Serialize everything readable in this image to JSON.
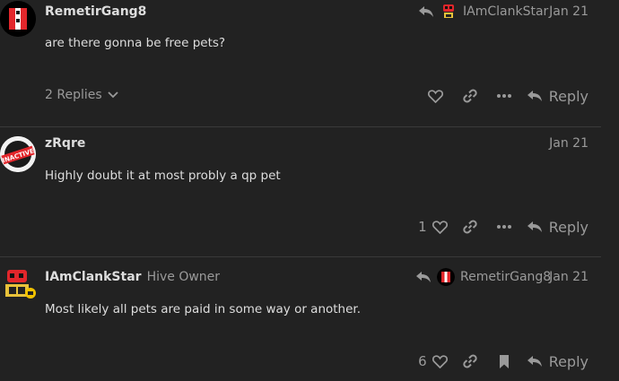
{
  "posts": [
    {
      "username": "RemetirGang8",
      "reply_to_user": "IAmClankStar",
      "date": "Jan 21",
      "body": "are there gonna be free pets?",
      "replies_label": "2 Replies",
      "reply_label": "Reply",
      "like_count": ""
    },
    {
      "username": "zRqre",
      "avatar_badge": "INACTIVE",
      "date": "Jan 21",
      "body": "Highly doubt it at most probly a qp pet",
      "like_count": "1",
      "reply_label": "Reply"
    },
    {
      "username": "IAmClankStar",
      "user_title": "Hive Owner",
      "reply_to_user": "RemetirGang8",
      "date": "Jan 21",
      "body": "Most likely all pets are paid in some way or another.",
      "like_count": "6",
      "reply_label": "Reply"
    }
  ],
  "colors": {
    "background": "#222222",
    "text": "#dddddd",
    "muted": "#9a9a9a",
    "divider": "#3a3a3a",
    "avatar_red": "#e2262b"
  }
}
